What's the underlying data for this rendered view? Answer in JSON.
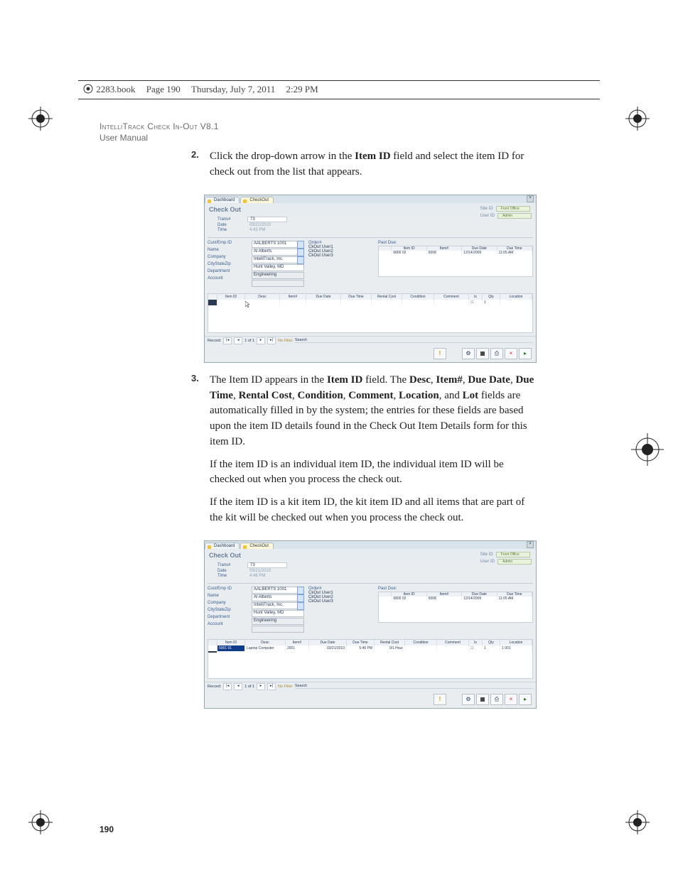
{
  "topbar": {
    "file": "2283.book",
    "page_str": "Page 190",
    "date": "Thursday, July 7, 2011",
    "time": "2:29 PM"
  },
  "running_head": {
    "line1": "IntelliTrack Check In-Out V8.1",
    "line2": "User Manual"
  },
  "page_number": "190",
  "step2": {
    "num": "2.",
    "text_a": "Click the drop-down arrow in the ",
    "bold_a": "Item ID",
    "text_b": " field and select the item ID for check out from the list that appears."
  },
  "step3": {
    "num": "3.",
    "p1_a": "The Item ID appears in the ",
    "p1_b1": "Item ID",
    "p1_c": " field. The ",
    "p1_b2": "Desc",
    "p1_s1": ", ",
    "p1_b3": "Item#",
    "p1_s2": ", ",
    "p1_b4": "Due Date",
    "p1_s3": ", ",
    "p1_b5": "Due Time",
    "p1_s4": ", ",
    "p1_b6": "Rental Cost",
    "p1_s5": ", ",
    "p1_b7": "Condition",
    "p1_s6": ", ",
    "p1_b8": "Comment",
    "p1_s7": ", ",
    "p1_b9": "Location",
    "p1_s8": ", and ",
    "p1_b10": "Lot",
    "p1_d": " fields are automatically filled in by the system; the entries for these fields are based upon the item ID details found in the Check Out Item Details form for this item ID.",
    "p2": "If the item ID is an individual item ID, the individual item ID will be checked out when you process the check out.",
    "p3": "If the item ID is a kit item ID, the kit item ID and all items that are part of the kit will be checked out when you process the check out."
  },
  "shot_common": {
    "tabs": {
      "dashboard": "Dashboard",
      "checkout": "CheckOut"
    },
    "title": "Check Out",
    "site": {
      "label": "Site ID",
      "value": "Front Office"
    },
    "user": {
      "label": "User ID",
      "value": "Admin"
    },
    "trans_label": "Trans#",
    "date_label": "Date",
    "time_label": "Time",
    "labels": {
      "cust": "Cust/Emp ID",
      "name": "Name",
      "company": "Company",
      "csz": "CityStateZip",
      "dept": "Department",
      "acct": "Account"
    },
    "orders_hdr": "Order#",
    "orders": [
      "CkOut User1",
      "CkOut User2",
      "CkOut User3"
    ],
    "past_due": "Past Due:",
    "mini_headers": [
      "Item ID",
      "Item#",
      "Due Date",
      "Due Time"
    ],
    "mini_row": [
      "6800 02",
      "6008",
      "12/14/2009",
      "11:05 AM"
    ],
    "grid_headers": [
      "Item ID",
      "Desc",
      "Item#",
      "Due Date",
      "Due Time",
      "Rental Cost",
      "Condition",
      "Comment",
      "Is",
      "Qty",
      "Location"
    ],
    "rec_label": "Record:",
    "rec_value": "1 of 1",
    "nofilter": "No Filter",
    "search": "Search"
  },
  "shot1": {
    "trans": "73",
    "date": "03/21/2010",
    "time": "4:43 PM",
    "vals": {
      "cust": "AALBERTS 1001",
      "name": "Al Alberts",
      "company": "IntelliTrack, Inc.",
      "csz": "Hunt Valley, MD",
      "dept": "Engineering",
      "acct": ""
    },
    "grid_row": {
      "qty": "1"
    }
  },
  "shot2": {
    "trans": "73",
    "date": "03/21/2010",
    "time": "4:46 PM",
    "vals": {
      "cust": "AALBERTS 1001",
      "name": "Al Alberts",
      "company": "IntelliTrack, Inc.",
      "csz": "Hunt Valley, MD",
      "dept": "Engineering",
      "acct": ""
    },
    "grid_row": {
      "item_id": "5001 01",
      "desc": "Laptop Computer",
      "itemno": "2001",
      "due_date": "03/21/2010",
      "due_time": "5:46 PM",
      "rental": "0/1 Hour",
      "qty": "1",
      "location": "1 001"
    }
  },
  "glyph": {
    "x": "×",
    "arrow": "▸",
    "left": "◂",
    "first": "|◂",
    "last": "▸|",
    "square": "■",
    "gear": "⚙",
    "print": "⎙"
  }
}
